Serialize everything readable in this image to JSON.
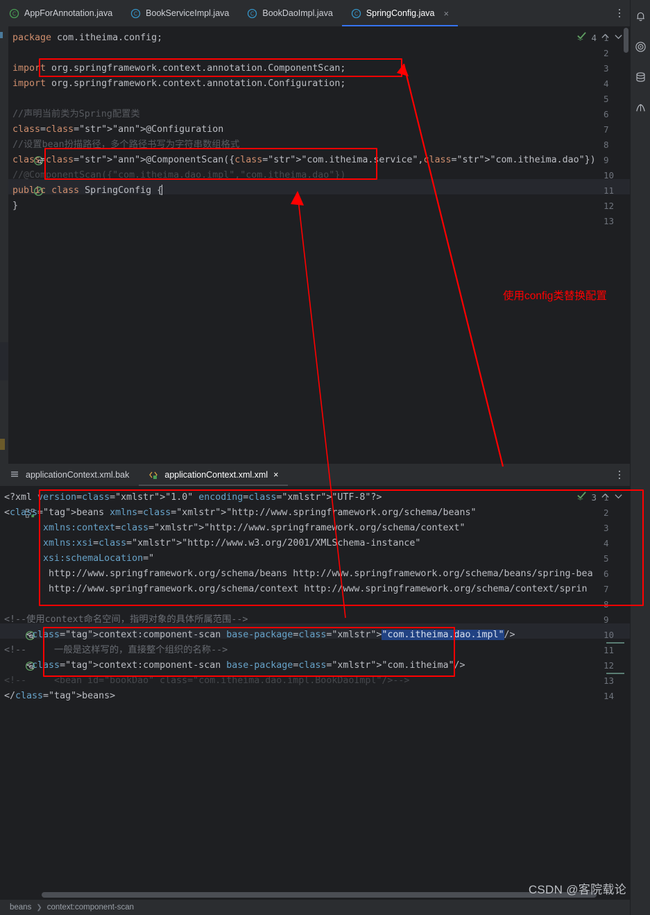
{
  "editor_top": {
    "tabs": [
      {
        "label": "AppForAnnotation.java",
        "icon": "java-class-icon",
        "active": false,
        "closable": false
      },
      {
        "label": "BookServiceImpl.java",
        "icon": "java-class-icon",
        "active": false,
        "closable": false
      },
      {
        "label": "BookDaoImpl.java",
        "icon": "java-class-icon",
        "active": false,
        "closable": false
      },
      {
        "label": "SpringConfig.java",
        "icon": "java-class-icon",
        "active": true,
        "closable": true
      }
    ],
    "close_label": "×",
    "overflow_menu": "more-tabs-menu",
    "inspection": {
      "count": "4",
      "icon": "inspection-check-icon",
      "up": "⌃",
      "down": "⌄"
    },
    "lines": [
      {
        "n": "1",
        "gutter": null,
        "text": "package com.itheima.config;"
      },
      {
        "n": "2",
        "gutter": null,
        "text": ""
      },
      {
        "n": "3",
        "gutter": null,
        "text": "import org.springframework.context.annotation.ComponentScan;"
      },
      {
        "n": "4",
        "gutter": null,
        "text": "import org.springframework.context.annotation.Configuration;"
      },
      {
        "n": "5",
        "gutter": null,
        "text": ""
      },
      {
        "n": "6",
        "gutter": null,
        "text": "//声明当前类为Spring配置类"
      },
      {
        "n": "7",
        "gutter": null,
        "text": "@Configuration"
      },
      {
        "n": "8",
        "gutter": null,
        "text": "//设置bean扮描路径，多个路径书写为字符串数组格式"
      },
      {
        "n": "9",
        "gutter": "bean-nav-icon",
        "text": "@ComponentScan({\"com.itheima.service\",\"com.itheima.dao\"})"
      },
      {
        "n": "10",
        "gutter": null,
        "text": "//@ComponentScan({\"com.itheima.dao.impl\",\"com.itheima.dao\"})"
      },
      {
        "n": "11",
        "gutter": "bean-disabled-icon",
        "text": "public class SpringConfig {"
      },
      {
        "n": "12",
        "gutter": null,
        "text": "}"
      },
      {
        "n": "13",
        "gutter": null,
        "text": ""
      }
    ]
  },
  "editor_bottom": {
    "tabs": [
      {
        "label": "applicationContext.xml.bak",
        "icon": "text-file-icon",
        "active": false,
        "closable": false
      },
      {
        "label": "applicationContext.xml.xml",
        "icon": "xml-file-icon",
        "active": true,
        "closable": true
      }
    ],
    "close_label": "×",
    "overflow_menu": "more-tabs-menu",
    "inspection": {
      "count": "3",
      "icon": "inspection-check-icon",
      "up": "⌃",
      "down": "⌄"
    },
    "lines": [
      {
        "n": "1",
        "gutter": null,
        "text": "<?xml version=\"1.0\" encoding=\"UTF-8\"?>"
      },
      {
        "n": "2",
        "gutter": "xml-bean-icon",
        "text": "<beans xmlns=\"http://www.springframework.org/schema/beans\""
      },
      {
        "n": "3",
        "gutter": null,
        "text": "       xmlns:context=\"http://www.springframework.org/schema/context\""
      },
      {
        "n": "4",
        "gutter": null,
        "text": "       xmlns:xsi=\"http://www.w3.org/2001/XMLSchema-instance\""
      },
      {
        "n": "5",
        "gutter": null,
        "text": "       xsi:schemaLocation=\""
      },
      {
        "n": "6",
        "gutter": null,
        "text": "        http://www.springframework.org/schema/beans http://www.springframework.org/schema/beans/spring-bea"
      },
      {
        "n": "7",
        "gutter": null,
        "text": "        http://www.springframework.org/schema/context http://www.springframework.org/schema/context/sprin"
      },
      {
        "n": "8",
        "gutter": null,
        "text": ""
      },
      {
        "n": "9",
        "gutter": null,
        "text": "<!--使用context命名空间，指明对象的具体所属范围-->"
      },
      {
        "n": "10",
        "gutter": "bean-nav-icon",
        "text": "    <context:component-scan base-package=\"com.itheima.dao.impl\"/>"
      },
      {
        "n": "11",
        "gutter": null,
        "text": "<!--     一般是这样写的，直接整个组织的名称-->"
      },
      {
        "n": "12",
        "gutter": "bean-nav-icon",
        "text": "    <context:component-scan base-package=\"com.itheima\"/>"
      },
      {
        "n": "13",
        "gutter": null,
        "text": "<!--     <bean id=\"bookDao\" class=\"com.itheima.dao.impl.BookDaoImpl\"/>-->"
      },
      {
        "n": "14",
        "gutter": null,
        "text": "</beans>"
      }
    ],
    "selection_value": "com.itheima.dao.impl",
    "highlight_value": "com"
  },
  "annotations": {
    "note_text": "使用config类替换配置",
    "color": "#ff0000",
    "boxes": [
      {
        "name": "import-componentscan-box"
      },
      {
        "name": "componentscan-annotation-box"
      },
      {
        "name": "xml-beans-header-box"
      },
      {
        "name": "xml-component-scan-box"
      }
    ]
  },
  "statusbar": {
    "breadcrumb": [
      "beans",
      "context:component-scan"
    ],
    "separator": "❯"
  },
  "watermark": {
    "text": "CSDN @客院载论"
  },
  "right_rail": [
    {
      "name": "notifications-icon"
    },
    {
      "name": "structure-target-icon"
    },
    {
      "name": "database-icon"
    },
    {
      "name": "maven-icon"
    }
  ],
  "theme": {
    "bg_editor": "#1e1f22",
    "bg_chrome": "#2b2d30",
    "accent_tab": "#3574f0",
    "keyword": "#cf8e6d",
    "string": "#6aab73",
    "comment": "#7a7e85",
    "annotation": "#bbb529",
    "xml_tag": "#c77dbb",
    "xml_attr": "#67a3c9",
    "selection": "#214283"
  }
}
